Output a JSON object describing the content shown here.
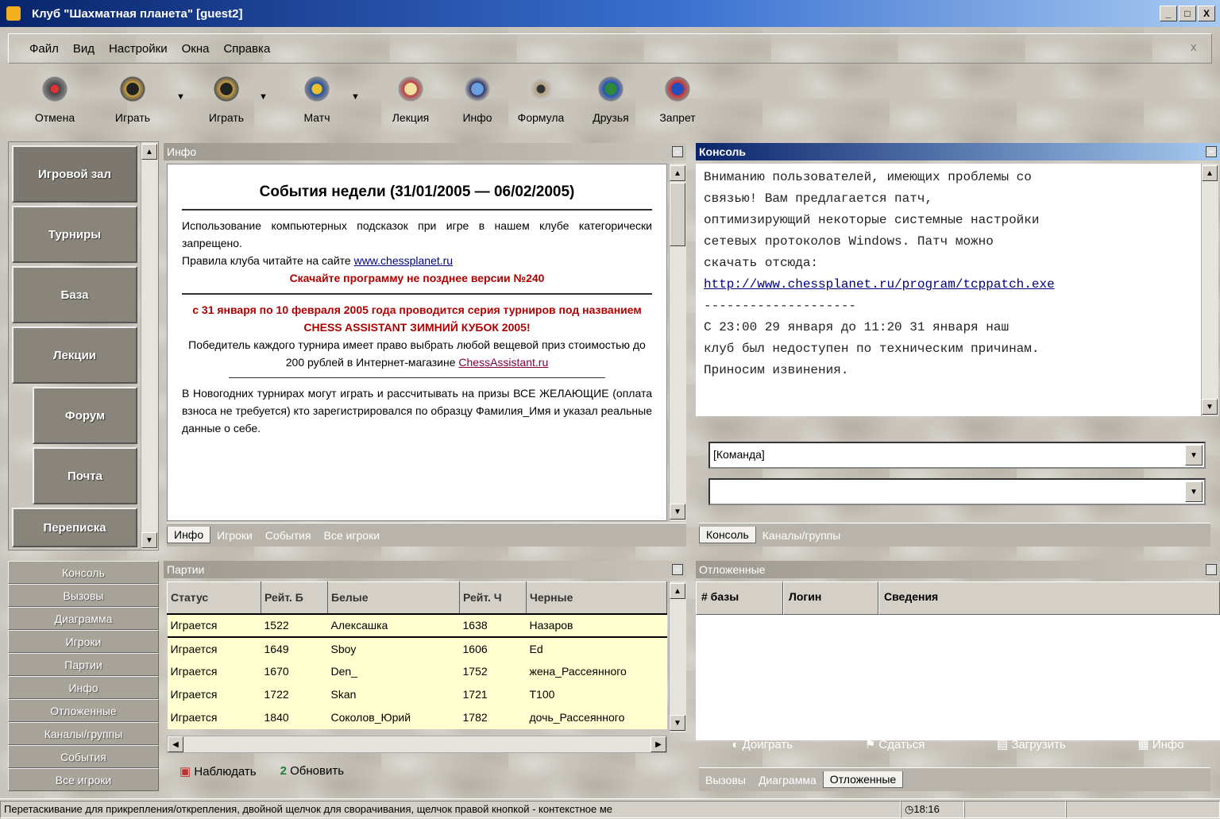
{
  "window": {
    "title": "Клуб \"Шахматная планета\" [guest2]",
    "controls": [
      "_",
      "□",
      "X"
    ]
  },
  "menu": {
    "items": [
      "Файл",
      "Вид",
      "Настройки",
      "Окна",
      "Справка"
    ],
    "close": "x"
  },
  "toolbar": {
    "items": [
      "Отмена",
      "Играть",
      "Играть",
      "Матч",
      "Лекция",
      "Инфо",
      "Формула",
      "Друзья",
      "Запрет"
    ]
  },
  "leftnav": {
    "items": [
      "Игровой зал",
      "Турниры",
      "База",
      "Лекции",
      "Форум",
      "Почта",
      "Переписка"
    ]
  },
  "leftlist": {
    "items": [
      "Консоль",
      "Вызовы",
      "Диаграмма",
      "Игроки",
      "Партии",
      "Инфо",
      "Отложенные",
      "Каналы/группы",
      "События",
      "Все игроки"
    ]
  },
  "info": {
    "title": "Инфо",
    "heading": "События недели (31/01/2005 — 06/02/2005)",
    "p1": "Использование компьютерных подсказок при игре в нашем клубе категорически запрещено.",
    "p1b": "Правила клуба читайте на сайте ",
    "p1link": "www.chessplanet.ru",
    "p1red": "Скачайте программу не позднее версии №240",
    "p2red": "с 31 января по 10 февраля 2005 года проводится серия турниров под названием CHESS ASSISTANT ЗИМНИЙ КУБОК 2005!",
    "p2": "Победитель каждого турнира имеет право выбрать любой вещевой приз стоимостью до 200 рублей в Интернет-магазине ",
    "p2link": "ChessAssistant.ru",
    "p3": "В Новогодних турнирах могут играть и рассчитывать на призы ВСЕ ЖЕЛАЮЩИЕ (оплата взноса не требуется) кто зарегистрировался по образцу Фамилия_Имя и указал реальные данные о себе.",
    "tabs": [
      "Инфо",
      "Игроки",
      "События",
      "Все игроки"
    ]
  },
  "console": {
    "title": "Консоль",
    "lines": [
      "Вниманию пользователей, имеющих проблемы со",
      "связью! Вам предлагается патч,",
      "оптимизирующий некоторые системные настройки",
      "сетевых протоколов Windows. Патч можно",
      "скачать отсюда:"
    ],
    "link": "http://www.chessplanet.ru/program/tcppatch.exe",
    "sep": "--------------------",
    "lines2": [
      "С 23:00 29 января до 11:20 31 января наш",
      "клуб был недоступен по техническим причинам.",
      "Приносим извинения."
    ],
    "combo1": "[Команда]",
    "combo2": "",
    "tabs": [
      "Консоль",
      "Каналы/группы"
    ]
  },
  "games": {
    "title": "Партии",
    "columns": [
      "Статус",
      "Рейт. Б",
      "Белые",
      "Рейт. Ч",
      "Черные"
    ],
    "rows": [
      [
        "Играется",
        "1522",
        "Алексашка",
        "1638",
        "Назаров"
      ],
      [
        "Играется",
        "1649",
        "Sboy",
        "1606",
        "Ed"
      ],
      [
        "Играется",
        "1670",
        "Den_",
        "1752",
        "жена_Рассеянного"
      ],
      [
        "Играется",
        "1722",
        "Skan",
        "1721",
        "T100"
      ],
      [
        "Играется",
        "1840",
        "Соколов_Юрий",
        "1782",
        "дочь_Рассеянного"
      ]
    ],
    "watch": "Наблюдать",
    "refresh": "Обновить",
    "refresh_num": "2"
  },
  "postponed": {
    "title": "Отложенные",
    "columns": [
      "# базы",
      "Логин",
      "Сведения"
    ],
    "buttons": [
      "Доиграть",
      "Сдаться",
      "Загрузить",
      "Инфо"
    ],
    "tabs": [
      "Вызовы",
      "Диаграмма",
      "Отложенные"
    ]
  },
  "status": {
    "text": "Перетаскивание для прикрепления/открепления, двойной щелчок для сворачивания, щелчок правой кнопкой - контекстное ме",
    "time": "18:16"
  }
}
